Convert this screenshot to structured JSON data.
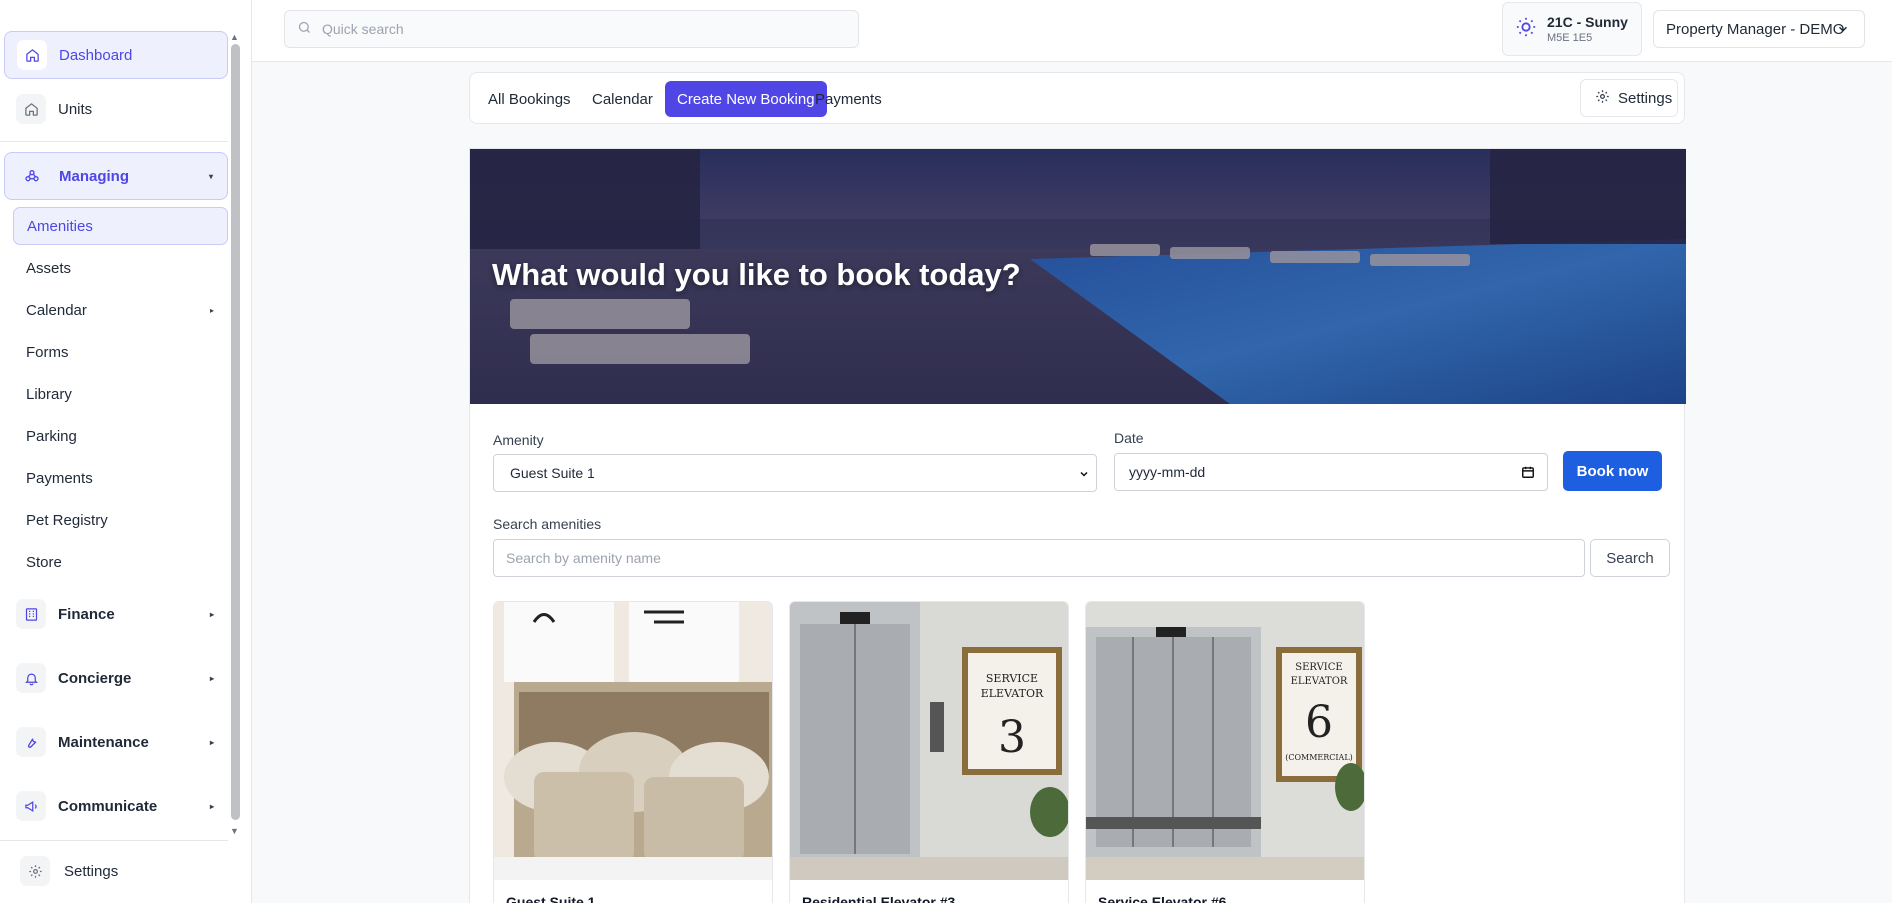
{
  "sidebar": {
    "items": [
      {
        "label": "Dashboard",
        "icon": "home-icon"
      },
      {
        "label": "Units",
        "icon": "home-icon"
      },
      {
        "label": "Managing",
        "icon": "network-icon"
      }
    ],
    "managing_subitems": [
      {
        "label": "Amenities"
      },
      {
        "label": "Assets"
      },
      {
        "label": "Calendar"
      },
      {
        "label": "Forms"
      },
      {
        "label": "Library"
      },
      {
        "label": "Parking"
      },
      {
        "label": "Payments"
      },
      {
        "label": "Pet Registry"
      },
      {
        "label": "Store"
      }
    ],
    "sections": [
      {
        "label": "Finance",
        "icon": "building-icon"
      },
      {
        "label": "Concierge",
        "icon": "bell-icon"
      },
      {
        "label": "Maintenance",
        "icon": "wrench-icon"
      },
      {
        "label": "Communicate",
        "icon": "megaphone-icon"
      }
    ],
    "settings_label": "Settings"
  },
  "header": {
    "search_placeholder": "Quick search",
    "weather": {
      "temp": "21C - Sunny",
      "postal": "M5E 1E5"
    },
    "user_menu": "Property Manager - DEMO"
  },
  "tabs": [
    {
      "label": "All Bookings"
    },
    {
      "label": "Calendar"
    },
    {
      "label": "Create New Booking"
    },
    {
      "label": "Payments"
    }
  ],
  "tabs_settings_label": "Settings",
  "hero": {
    "title": "What would you like to book today?"
  },
  "form": {
    "amenity_label": "Amenity",
    "amenity_value": "Guest Suite 1",
    "date_label": "Date",
    "date_placeholder": "yyyy-mm-dd",
    "book_label": "Book now",
    "search_label": "Search amenities",
    "search_placeholder": "Search by amenity name",
    "search_button": "Search"
  },
  "amenities": [
    {
      "name": "Guest Suite 1"
    },
    {
      "name": "Residential Elevator #3"
    },
    {
      "name": "Service Elevator #6"
    }
  ],
  "colors": {
    "accent": "#4f46e5",
    "primary_button": "#1d5fe0"
  }
}
